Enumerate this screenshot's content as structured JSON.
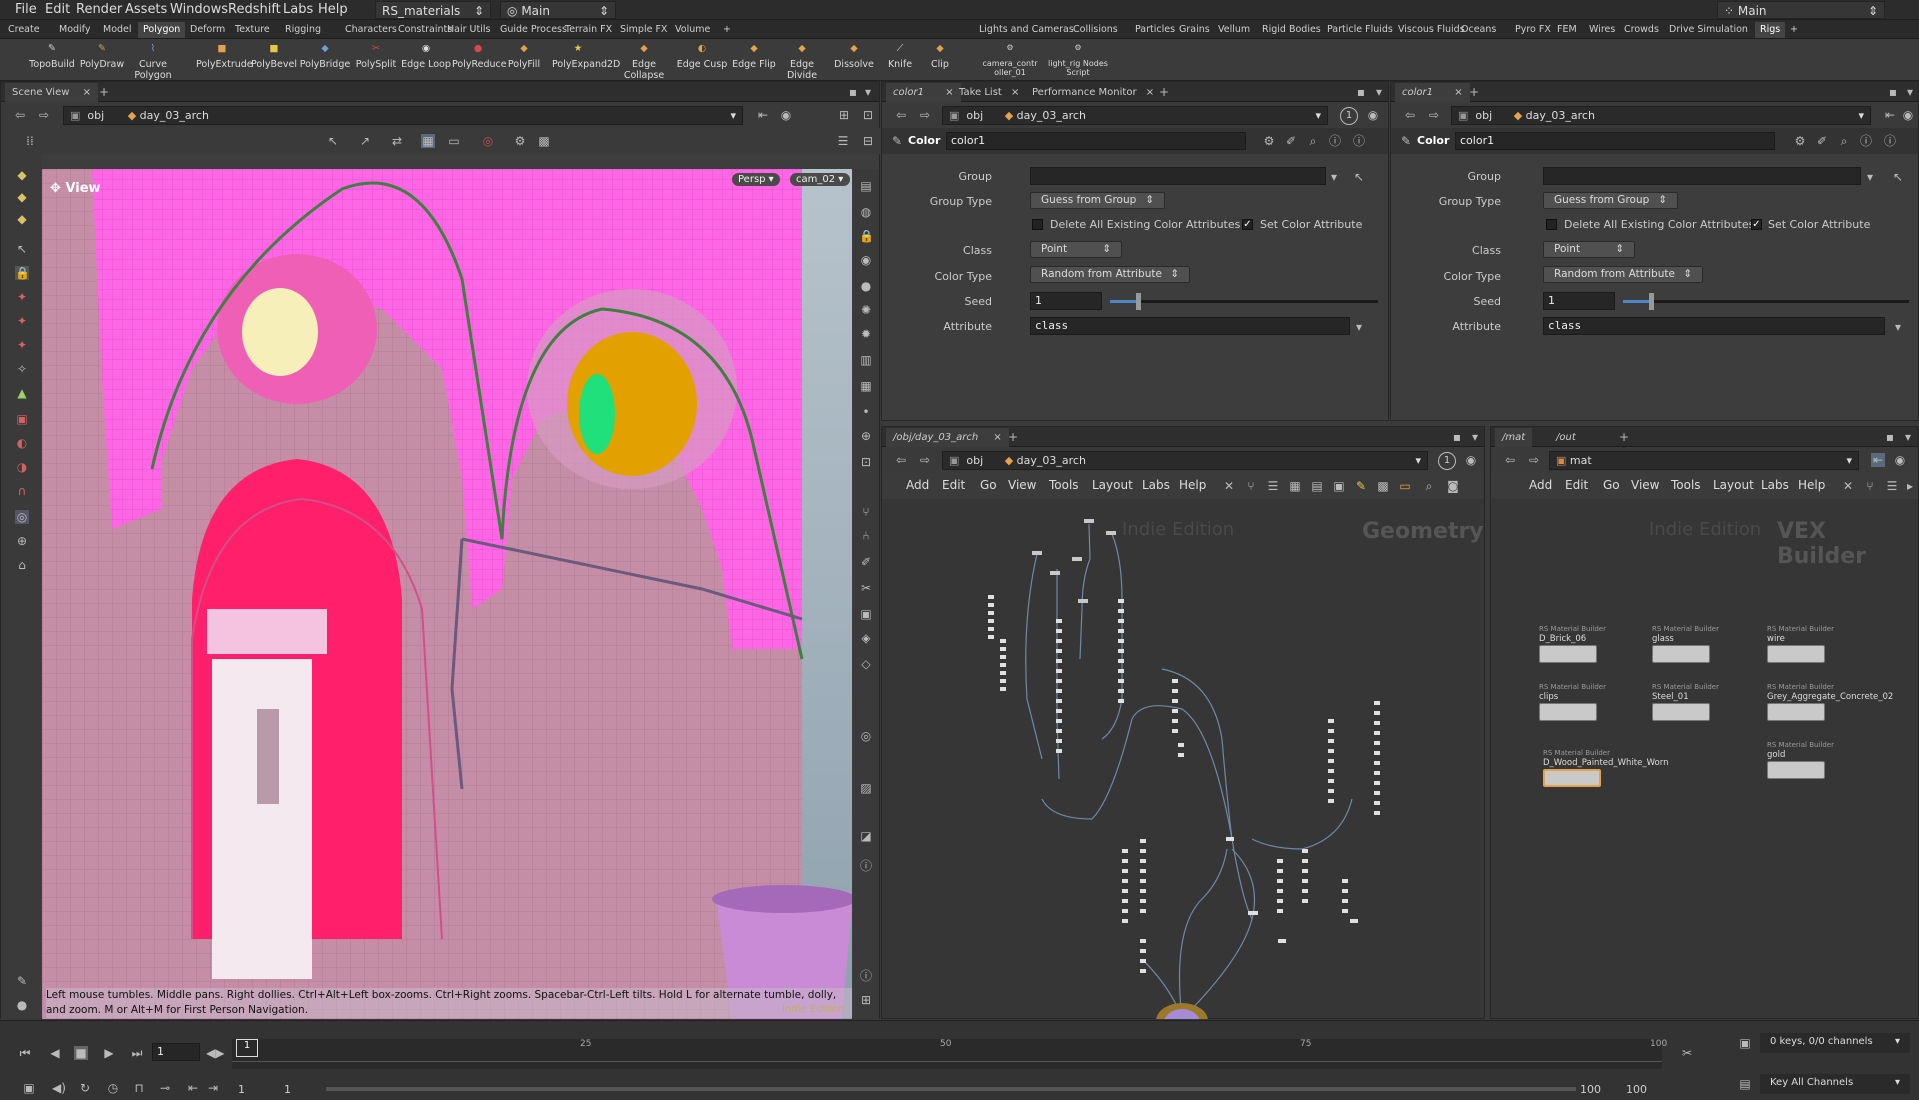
{
  "menu": [
    "File",
    "Edit",
    "Render",
    "Assets",
    "Windows",
    "Redshift",
    "Labs",
    "Help"
  ],
  "desktop": "RS_materials",
  "desktop_tab": "Main",
  "main_right": "Main",
  "shelf_tabs_left": [
    "Create",
    "Modify",
    "Model",
    "Polygon",
    "Deform",
    "Texture",
    "Rigging",
    "Characters",
    "Constraints",
    "Hair Utils",
    "Guide Process",
    "Terrain FX",
    "Simple FX",
    "Volume"
  ],
  "shelf_tabs_right": [
    "Lights and Cameras",
    "Collisions",
    "Particles",
    "Grains",
    "Vellum",
    "Rigid Bodies",
    "Particle Fluids",
    "Viscous Fluids",
    "Oceans",
    "Pyro FX",
    "FEM",
    "Wires",
    "Crowds",
    "Drive Simulation",
    "Rigs"
  ],
  "tools": [
    "TopoBuild",
    "PolyDraw",
    "Curve Polygon",
    "PolyExtrude",
    "PolyBevel",
    "PolyBridge",
    "PolySplit",
    "Edge Loop",
    "PolyReduce",
    "PolyFill",
    "PolyExpand2D",
    "Edge Collapse",
    "Edge Cusp",
    "Edge Flip",
    "Edge Divide",
    "Dissolve",
    "Knife",
    "Clip"
  ],
  "tools_right": [
    "camera_contr oller_01",
    "light_rig Nodes Script"
  ],
  "viewer": {
    "tab": "Scene View",
    "path_obj": "obj",
    "path_node": "day_03_arch",
    "view_label": "View",
    "persp": "Persp",
    "cam": "cam_02",
    "status": "Left mouse tumbles. Middle pans. Right dollies. Ctrl+Alt+Left box-zooms. Ctrl+Right zooms. Spacebar-Ctrl-Left tilts. Hold L for alternate tumble, dolly, and zoom. M or Alt+M for First Person Navigation.",
    "edition": "Indie Edition"
  },
  "param_left": {
    "tabs": [
      "color1",
      "Take List",
      "Performance Monitor"
    ],
    "path_obj": "obj",
    "path_node": "day_03_arch",
    "node_type": "Color",
    "node_name": "color1",
    "group_label": "Group",
    "group_value": "",
    "group_type_label": "Group Type",
    "group_type": "Guess from Group",
    "delete_label": "Delete All Existing Color Attributes",
    "set_label": "Set Color Attribute",
    "class_label": "Class",
    "class_value": "Point",
    "color_type_label": "Color Type",
    "color_type": "Random from Attribute",
    "seed_label": "Seed",
    "seed": "1",
    "attr_label": "Attribute",
    "attr": "class",
    "frame": "1"
  },
  "param_right": {
    "tabs": [
      "color1"
    ],
    "path_obj": "obj",
    "path_node": "day_03_arch",
    "node_type": "Color",
    "node_name": "color1",
    "group_label": "Group",
    "group_value": "",
    "group_type_label": "Group Type",
    "group_type": "Guess from Group",
    "delete_label": "Delete All Existing Color Attributes",
    "set_label": "Set Color Attribute",
    "class_label": "Class",
    "class_value": "Point",
    "color_type_label": "Color Type",
    "color_type": "Random from Attribute",
    "seed_label": "Seed",
    "seed": "1",
    "attr_label": "Attribute",
    "attr": "class"
  },
  "net_left": {
    "tab": "/obj/day_03_arch",
    "path_obj": "obj",
    "path_node": "day_03_arch",
    "menu": [
      "Add",
      "Edit",
      "Go",
      "View",
      "Tools",
      "Layout",
      "Labs",
      "Help"
    ],
    "watermark": "Indie Edition",
    "context": "Geometry",
    "frame": "1"
  },
  "net_right": {
    "tabs": [
      "/mat",
      "/out"
    ],
    "path": "mat",
    "menu": [
      "Add",
      "Edit",
      "Go",
      "View",
      "Tools",
      "Layout",
      "Labs",
      "Help"
    ],
    "watermark": "Indie Edition",
    "context": "VEX Builder",
    "materials": [
      {
        "type": "RS Material Builder",
        "name": "D_Brick_06"
      },
      {
        "type": "RS Material Builder",
        "name": "glass"
      },
      {
        "type": "RS Material Builder",
        "name": "wire"
      },
      {
        "type": "RS Material Builder",
        "name": "clips"
      },
      {
        "type": "RS Material Builder",
        "name": "Steel_01"
      },
      {
        "type": "RS Material Builder",
        "name": "Grey_Aggregate_Concrete_02"
      },
      {
        "type": "RS Material Builder",
        "name": "D_Wood_Painted_White_Worn"
      },
      {
        "type": "RS Material Builder",
        "name": "gold"
      }
    ]
  },
  "timeline": {
    "frame": "1",
    "ticks": [
      "1",
      "25",
      "50",
      "75",
      "100"
    ],
    "start": "1",
    "start2": "1",
    "end": "100",
    "end2": "100",
    "keys": "0 keys, 0/0 channels",
    "key_all": "Key All Channels"
  }
}
